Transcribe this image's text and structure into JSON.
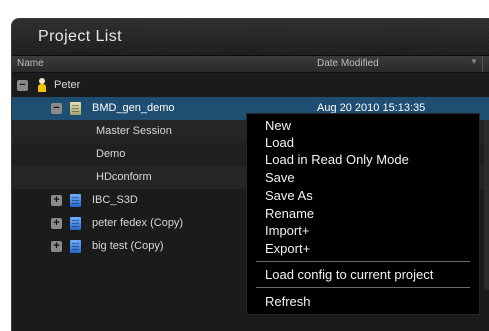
{
  "window": {
    "title": "Project List"
  },
  "columns": {
    "name": "Name",
    "date_modified": "Date Modified"
  },
  "tree": {
    "user": {
      "label": "Peter",
      "toggle": "−"
    },
    "project": {
      "label": "BMD_gen_demo",
      "date": "Aug 20 2010 15:13:35",
      "toggle": "−"
    },
    "children": [
      {
        "label": "Master Session"
      },
      {
        "label": "Demo"
      },
      {
        "label": "HDconform"
      }
    ],
    "others": [
      {
        "label": "IBC_S3D",
        "toggle": "+"
      },
      {
        "label": "peter fedex (Copy)",
        "toggle": "+"
      },
      {
        "label": "big test (Copy)",
        "toggle": "+"
      }
    ]
  },
  "context_menu": {
    "items": [
      "New",
      "Load",
      "Load in Read Only Mode",
      "Save",
      "Save As",
      "Rename",
      "Import+",
      "Export+",
      "Load config to current project",
      "Refresh"
    ]
  },
  "colors": {
    "selection": "#1e4f73",
    "panel": "#1b1b1b",
    "menu": "#000000"
  }
}
